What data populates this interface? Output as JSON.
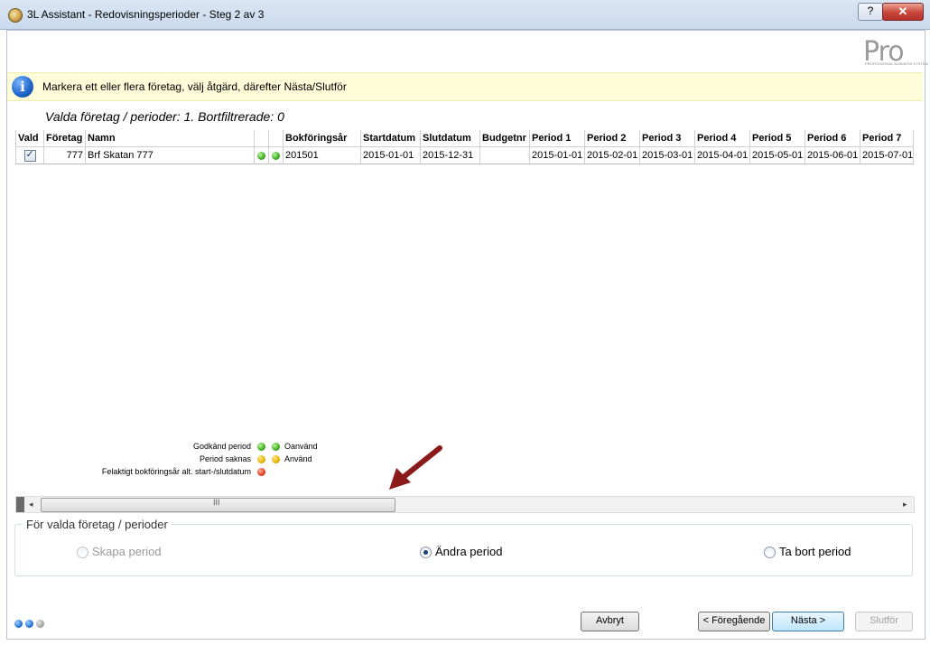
{
  "window": {
    "title": "3L Assistant - Redovisningsperioder - Steg 2 av 3",
    "help_label": "?",
    "close_label": "✕"
  },
  "logo": {
    "text": "Pro",
    "subtitle": "PROFESSIONAL BUSINESS SYSTEM"
  },
  "info": {
    "icon": "info-icon",
    "text": "Markera ett eller flera företag, välj åtgärd, därefter Nästa/Slutför"
  },
  "summary": "Valda företag / perioder: 1. Bortfiltrerade: 0",
  "table": {
    "headers": [
      "Vald",
      "Företag",
      "Namn",
      "",
      "",
      "Bokföringsår",
      "Startdatum",
      "Slutdatum",
      "Budgetnr",
      "Period 1",
      "Period 2",
      "Period 3",
      "Period 4",
      "Period 5",
      "Period 6",
      "Period 7"
    ],
    "rows": [
      {
        "checked": true,
        "foretag": "777",
        "namn": "Brf Skatan 777",
        "status1": "green",
        "status2": "green",
        "bokforingsar": "201501",
        "startdatum": "2015-01-01",
        "slutdatum": "2015-12-31",
        "budgetnr": "",
        "p1": "2015-01-01",
        "p2": "2015-02-01",
        "p3": "2015-03-01",
        "p4": "2015-04-01",
        "p5": "2015-05-01",
        "p6": "2015-06-01",
        "p7": "2015-07-01"
      }
    ]
  },
  "legend": {
    "godkand": "Godkänd period",
    "saknas": "Period saknas",
    "felaktigt": "Felaktigt bokföringsår alt. start-/slutdatum",
    "oanvand": "Oanvänd",
    "anvand": "Använd"
  },
  "scrollbar": {
    "grip": "III"
  },
  "group": {
    "title": "För valda företag / perioder",
    "options": [
      {
        "label": "Skapa period",
        "checked": false,
        "disabled": true
      },
      {
        "label": "Ändra period",
        "checked": true,
        "disabled": false
      },
      {
        "label": "Ta bort period",
        "checked": false,
        "disabled": false
      }
    ]
  },
  "buttons": {
    "avbryt": "Avbryt",
    "foregaende": "< Föregående",
    "nasta": "Nästa >",
    "slutfor": "Slutför"
  },
  "colors": {
    "accent": "#1e63c9",
    "info_bg": "#fefcd9",
    "arrow": "#8b1a1a"
  }
}
